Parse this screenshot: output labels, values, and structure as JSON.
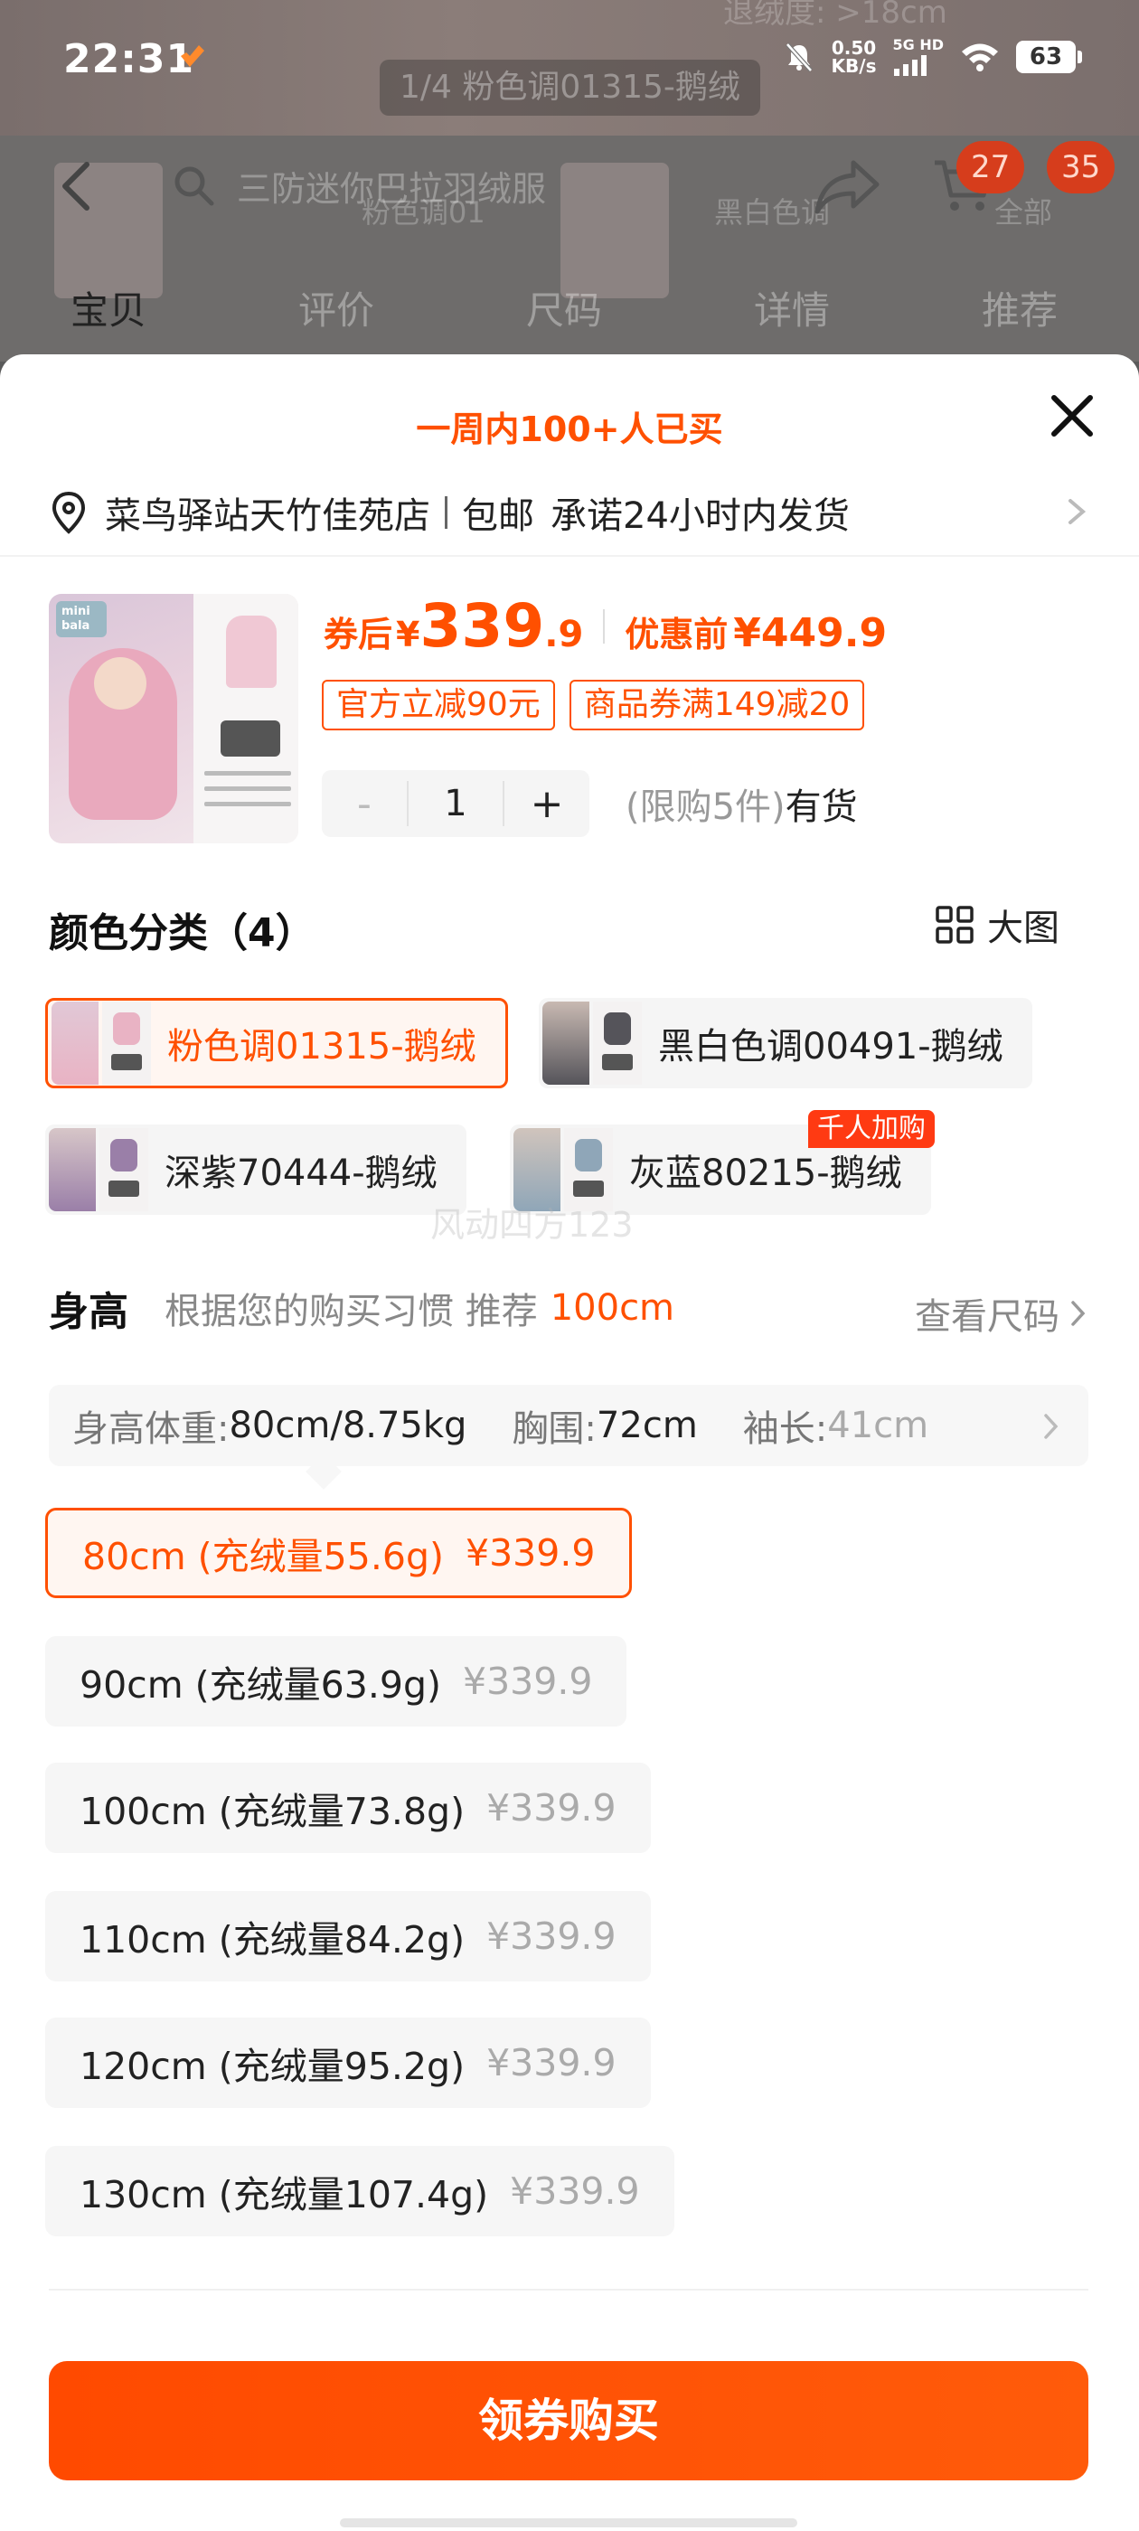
{
  "status_bar": {
    "time": "22:31",
    "speed_value": "0.50",
    "speed_unit": "KB/s",
    "network": "5G HD",
    "battery": "63"
  },
  "background": {
    "faint_header": "退绒度: >18cm",
    "image_counter": "1/4 粉色调01315-鹅绒",
    "search_placeholder": "三防迷你巴拉羽绒服",
    "thumb_label_1": "粉色调01",
    "thumb_label_2": "黑白色调",
    "thumb_label_3": "全部",
    "cart_badge": "27",
    "more_badge": "35",
    "tabs": [
      "宝贝",
      "评价",
      "尺码",
      "详情",
      "推荐"
    ]
  },
  "sheet": {
    "sold_text": "一周内100+人已买",
    "delivery": {
      "location": "菜鸟驿站天竹佳苑店",
      "shipping": "包邮",
      "promise": "承诺24小时内发货"
    },
    "product": {
      "logo_text": "mini bala",
      "price_label": "券后",
      "currency": "¥",
      "price_int": "339",
      "price_dec": ".9",
      "orig_label": "优惠前",
      "orig_price": "¥449.9",
      "coupons": [
        "官方立减90元",
        "商品券满149减20"
      ],
      "quantity_minus": "-",
      "quantity": "1",
      "quantity_plus": "+",
      "limit": "(限购5件)",
      "stock": "有货"
    },
    "color_section": {
      "title": "颜色分类（4）",
      "big_image": "大图",
      "options": [
        {
          "label": "粉色调01315-鹅绒",
          "selected": true,
          "tone": "#e9b3c4"
        },
        {
          "label": "黑白色调00491-鹅绒",
          "selected": false,
          "tone": "#55545a"
        },
        {
          "label": "深紫70444-鹅绒",
          "selected": false,
          "tone": "#9a7fa8"
        },
        {
          "label": "灰蓝80215-鹅绒",
          "selected": false,
          "tone": "#8fa6b8"
        }
      ],
      "hot_tag": "千人加购",
      "watermark": "风动四方123"
    },
    "height_section": {
      "title": "身高",
      "hint": "根据您的购买习惯 推荐",
      "recommend": "100cm",
      "size_guide": "查看尺码",
      "info": {
        "k1": "身高体重: ",
        "v1": "80cm/8.75kg",
        "k2": "胸围: ",
        "v2": "72cm",
        "k3": "袖长: ",
        "v3": "41cm"
      },
      "options": [
        {
          "label": "80cm (充绒量55.6g)",
          "price": "¥339.9",
          "selected": true
        },
        {
          "label": "90cm (充绒量63.9g)",
          "price": "¥339.9",
          "selected": false
        },
        {
          "label": "100cm (充绒量73.8g)",
          "price": "¥339.9",
          "selected": false
        },
        {
          "label": "110cm (充绒量84.2g)",
          "price": "¥339.9",
          "selected": false
        },
        {
          "label": "120cm (充绒量95.2g)",
          "price": "¥339.9",
          "selected": false
        },
        {
          "label": "130cm (充绒量107.4g)",
          "price": "¥339.9",
          "selected": false
        }
      ]
    },
    "buy_button": "领券购买"
  }
}
